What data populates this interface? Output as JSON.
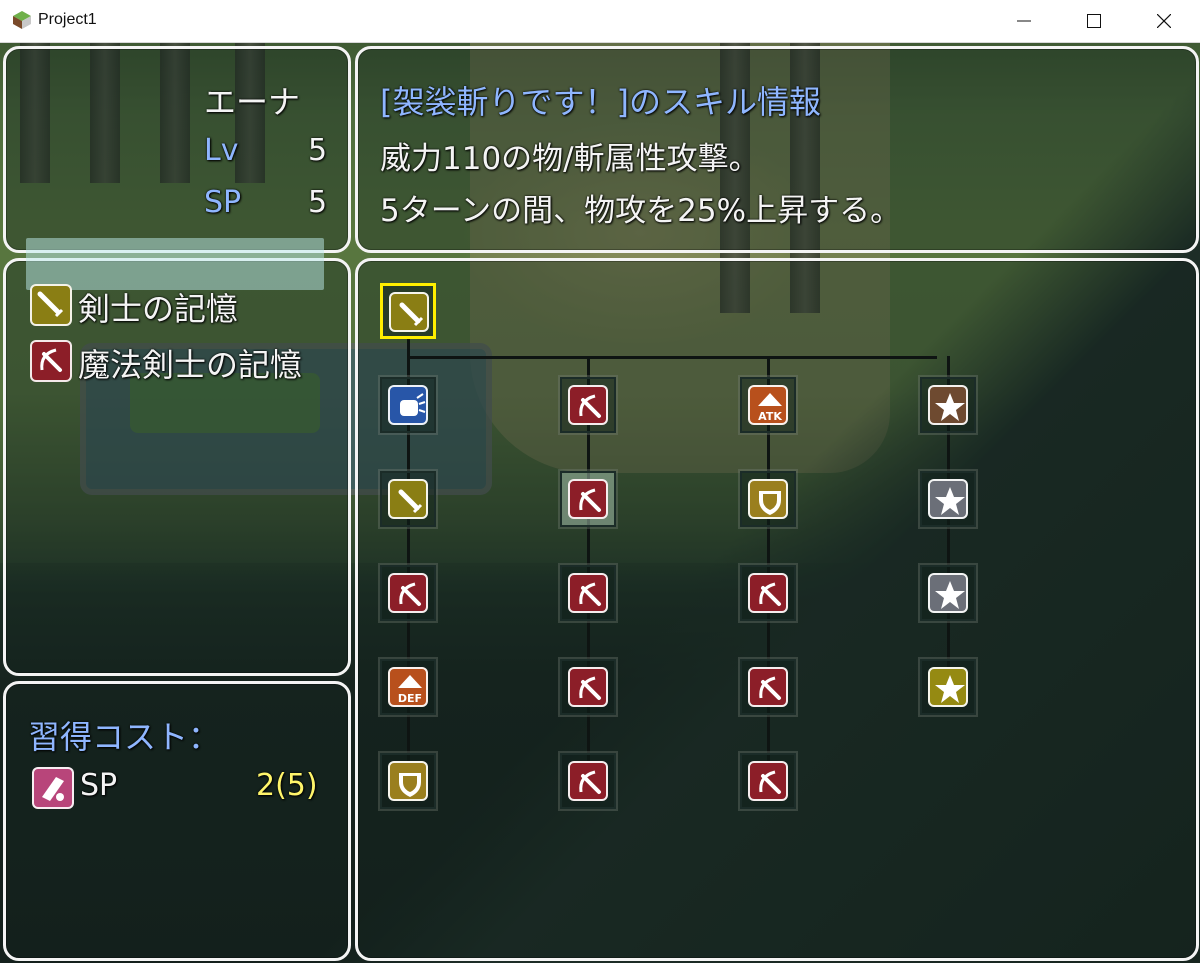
{
  "window": {
    "title": "Project1",
    "minimize": "minimize",
    "maximize": "maximize",
    "close": "close"
  },
  "actor": {
    "name": "エーナ",
    "lv_label": "Lv",
    "lv_value": "5",
    "sp_label": "SP",
    "sp_value": "5"
  },
  "skill_info": {
    "heading": "[袈裟斬りです！]のスキル情報",
    "line1": "威力110の物/斬属性攻撃。",
    "line2": "5ターンの間、物攻を25%上昇する。"
  },
  "categories": [
    {
      "label": "剣士の記憶",
      "icon": "sword-icon",
      "selected": true
    },
    {
      "label": "魔法剣士の記憶",
      "icon": "magic-sword-icon",
      "selected": false
    }
  ],
  "cost": {
    "heading": "習得コスト：",
    "item_label": "SP",
    "item_value": "2(5)",
    "icon": "scroll-icon"
  },
  "tree": {
    "root": {
      "icon": "sword-icon",
      "color": "#8a7e14",
      "selected": true
    },
    "columns": [
      [
        "fist-icon",
        "sword-icon",
        "magic-sword-icon",
        "def-up-icon",
        "shield-icon"
      ],
      [
        "magic-sword-icon",
        "magic-sword-icon",
        "magic-sword-icon",
        "magic-sword-icon",
        "magic-sword-icon"
      ],
      [
        "atk-up-icon",
        "shield-icon",
        "magic-sword-icon",
        "magic-sword-icon",
        "magic-sword-icon"
      ],
      [
        "star-icon",
        "star-icon",
        "star-icon",
        "star-icon"
      ]
    ],
    "atk_text": "ATK",
    "def_text": "DEF"
  },
  "colors": {
    "accent_blue": "#8fb6ff",
    "cost_yellow": "#fff56a",
    "cursor": "#ffee00",
    "window_border": "#f4f4f4"
  }
}
